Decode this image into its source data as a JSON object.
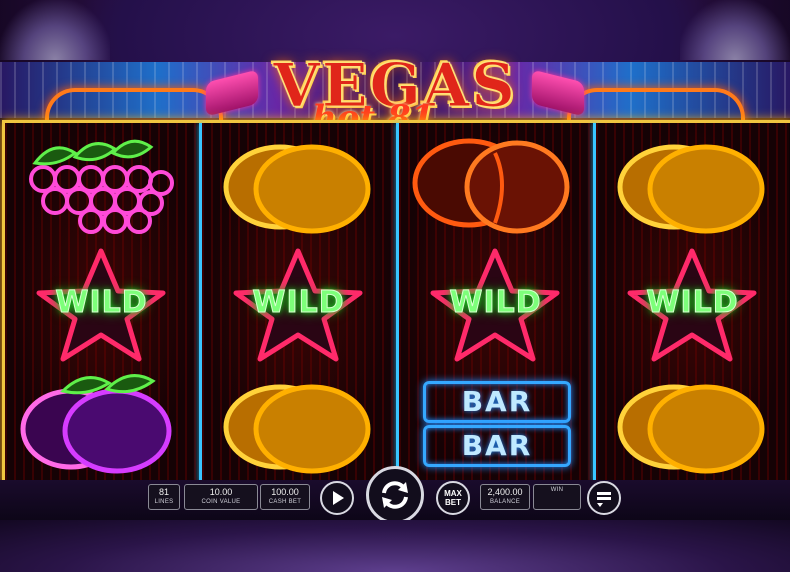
{
  "game": {
    "logo_line1": "VEGAS",
    "logo_line2": "hot 81"
  },
  "reels": [
    [
      "grapes",
      "wild",
      "plum"
    ],
    [
      "lemon",
      "wild",
      "lemon"
    ],
    [
      "orange",
      "wild",
      "bar"
    ],
    [
      "lemon",
      "wild",
      "lemon"
    ]
  ],
  "symbols": {
    "wild_label": "WILD",
    "bar_label": "BAR"
  },
  "controls": {
    "lines_value": "81",
    "lines_label": "LINES",
    "coin_value": "10.00",
    "coin_label": "COIN VALUE",
    "cash_bet_value": "100.00",
    "cash_bet_label": "CASH BET",
    "play_icon": "play-icon",
    "spin_icon": "spin-arrows-icon",
    "max_bet_line1": "MAX",
    "max_bet_line2": "BET",
    "balance_value": "2,400.00",
    "balance_label": "BALANCE",
    "win_value": "",
    "win_label": "WIN",
    "menu_icon": "menu-icon"
  },
  "colors": {
    "reel_border": "#f0c640",
    "separator": "#39c6ff",
    "wild_star": "#ff2a6a",
    "wild_text": "#7dff7a",
    "lemon": "#ffb000",
    "orange": "#ff5a10",
    "grapes": "#ff4ad8",
    "plum": "#d63cff",
    "bar": "#35a8ff"
  }
}
